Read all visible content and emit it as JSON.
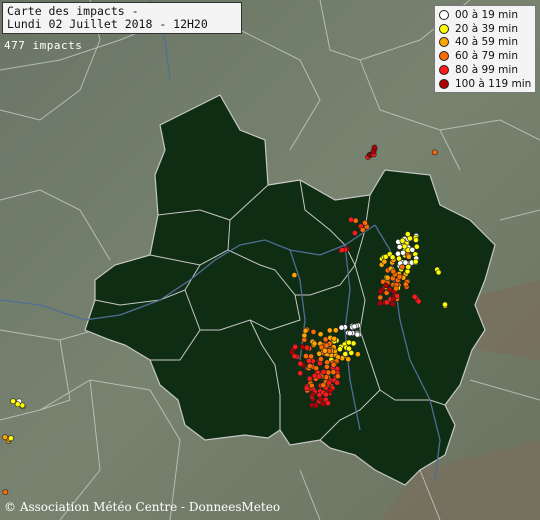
{
  "title": {
    "line1": "Carte des impacts -",
    "line2": "Lundi 02 Juillet 2018 - 12H20"
  },
  "impacts_count": "477 impacts",
  "legend": [
    {
      "label": "00 à 19 min",
      "color": "#ffffff"
    },
    {
      "label": "20 à 39 min",
      "color": "#ffff00"
    },
    {
      "label": "40 à 59 min",
      "color": "#ffa500"
    },
    {
      "label": "60 à 79 min",
      "color": "#ff6a00"
    },
    {
      "label": "80 à 99 min",
      "color": "#ff1a1a"
    },
    {
      "label": "100 à 119 min",
      "color": "#b00000"
    }
  ],
  "copyright": "© Association Météo Centre - DonneesMeteo",
  "colors": {
    "background": "#6f7c6c",
    "region_fill": "#0f2d13",
    "border": "#c7c7c7",
    "river": "#4f6e95"
  }
}
